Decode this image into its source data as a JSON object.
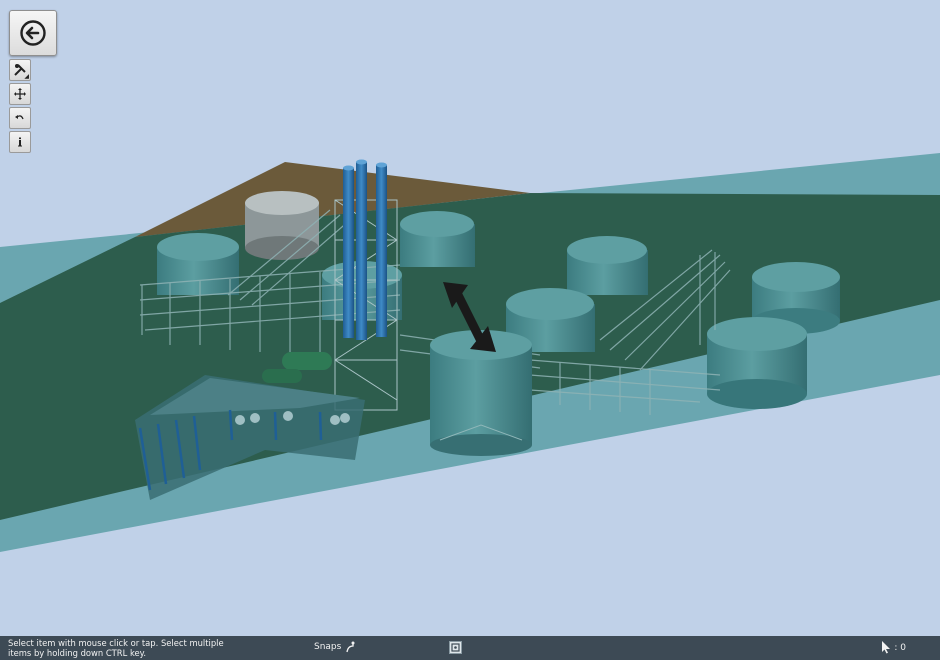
{
  "toolbar": {
    "back": "back-arrow-icon",
    "tools": [
      "tools-icon",
      "move-icon",
      "undo-icon",
      "info-icon"
    ]
  },
  "status": {
    "hint": "Select item with mouse click or tap. Select multiple items by holding down CTRL key.",
    "snaps_label": "Snaps",
    "selection_count": ": 0"
  },
  "colors": {
    "sky": "#c0d1e8",
    "ground": "#2a5a49",
    "water": "#6aa6b0",
    "tank": "#4d8f92",
    "stack": "#2f72a8",
    "statusbar": "#3d4a55"
  }
}
